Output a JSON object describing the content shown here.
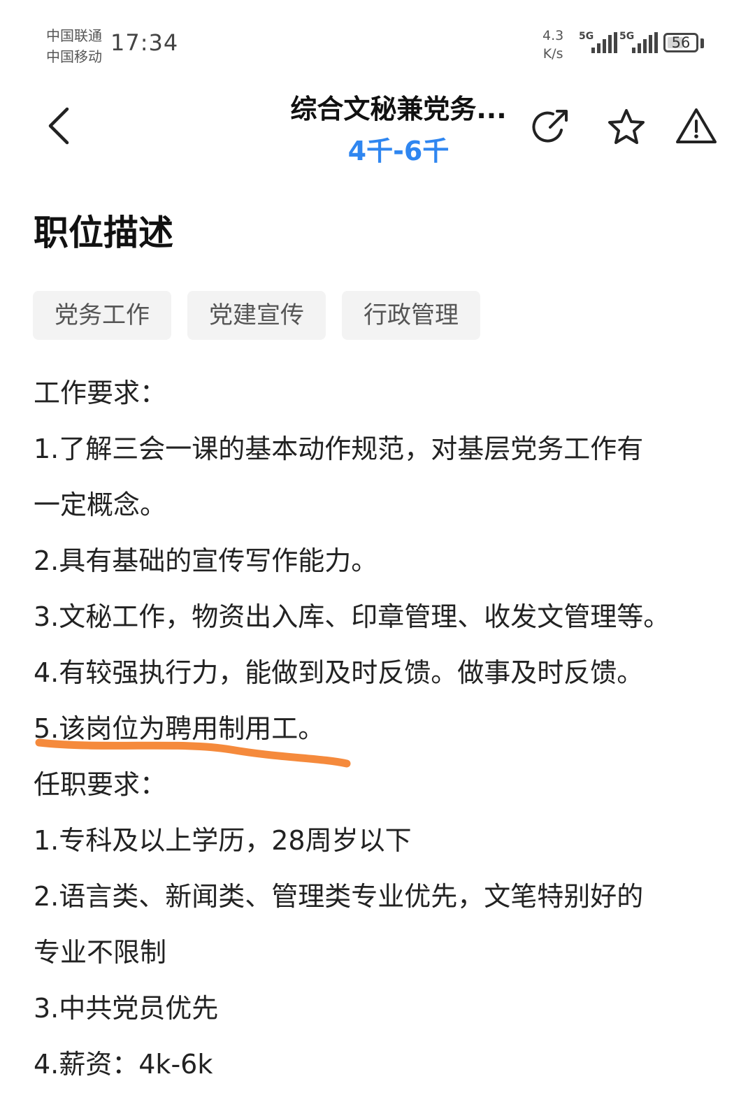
{
  "status_bar": {
    "carrier_1": "中国联通",
    "carrier_2": "中国移动",
    "time": "17:34",
    "net_speed_value": "4.3",
    "net_speed_unit": "K/s",
    "signal_1_label": "5G",
    "signal_2_label": "5G",
    "battery_level": "56"
  },
  "header": {
    "title": "综合文秘兼党务...",
    "salary": "4千-6千"
  },
  "section": {
    "title": "职位描述",
    "tags": [
      "党务工作",
      "党建宣传",
      "行政管理"
    ]
  },
  "description_lines": [
    "工作要求：",
    "1.了解三会一课的基本动作规范，对基层党务工作有",
    "一定概念。",
    "2.具有基础的宣传写作能力。",
    "3.文秘工作，物资出入库、印章管理、收发文管理等。",
    "4.有较强执行力，能做到及时反馈。做事及时反馈。",
    "5.该岗位为聘用制用工。",
    "任职要求：",
    "1.专科及以上学历，28周岁以下",
    "2.语言类、新闻类、管理类专业优先，文笔特别好的",
    "专业不限制",
    "3.中共党员优先",
    "4.薪资：4k-6k"
  ],
  "colors": {
    "salary": "#2f86f0",
    "highlight_underline": "#f58a3c",
    "tag_background": "#f3f3f3"
  },
  "icons": [
    "back-arrow-icon",
    "share-icon",
    "star-icon",
    "warning-icon"
  ]
}
